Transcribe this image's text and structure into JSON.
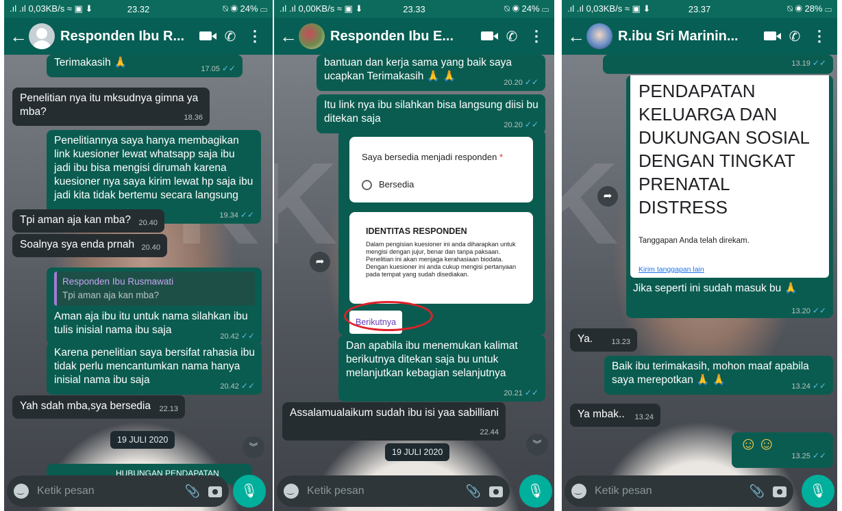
{
  "panel1": {
    "status": {
      "left": ".ıl .ıl 0,03KB/s ≈ ▣ ⬇",
      "time": "23.32",
      "right": "⍉ ◉ 24% ▭"
    },
    "header": {
      "title": "Responden Ibu R..."
    },
    "messages": [
      {
        "text": "Terimakasih 🙏",
        "time": "17.05"
      },
      {
        "text": "Penelitian nya itu mksudnya gimna ya mba?",
        "time": "18.36"
      },
      {
        "text": "Penelitiannya saya hanya membagikan link kuesioner lewat whatsapp saja ibu jadi ibu bisa mengisi dirumah karena kuesioner nya saya kirim lewat hp saja ibu jadi kita tidak bertemu secara langsung",
        "time": "19.34"
      },
      {
        "text": "Tpi aman aja kan mba?",
        "time": "20.40"
      },
      {
        "text": "Soalnya sya enda prnah",
        "time": "20.40"
      },
      {
        "quote_name": "Responden Ibu Rusmawati",
        "quote_text": "Tpi aman aja kan mba?",
        "text": "Aman aja ibu itu untuk nama silahkan ibu tulis inisial nama ibu saja",
        "time": "20.42"
      },
      {
        "text": "Karena penelitian saya bersifat rahasia ibu tidak perlu mencantumkan nama hanya inisial nama ibu saja",
        "time": "20.42"
      },
      {
        "text": "Yah sdah mba,sya bersedia",
        "time": "22.13"
      }
    ],
    "date": "19 JULI 2020",
    "partial": "HUBUNGAN PENDAPATAN",
    "input_placeholder": "Ketik pesan"
  },
  "panel2": {
    "status": {
      "left": ".ıl .ıl 0,00KB/s ≈ ▣ ⬇",
      "time": "23.33",
      "right": "⍉ ◉ 24% ▭"
    },
    "header": {
      "title": "Responden Ibu E..."
    },
    "messages": [
      {
        "text": "bantuan dan kerja sama yang baik saya ucapkan Terimakasih 🙏 🙏",
        "time": "20.20"
      },
      {
        "text": "Itu link nya ibu silahkan bisa langsung diisi bu ditekan saja",
        "time": "20.20"
      },
      {
        "text": "Dan apabila ibu menemukan kalimat berikutnya ditekan saja bu untuk melanjutkan kebagian selanjutnya",
        "time": "20.21"
      },
      {
        "text": "Assalamualaikum sudah ibu isi yaa sabilliani",
        "time": "22.44"
      }
    ],
    "form": {
      "question": "Saya bersedia menjadi responden",
      "required": "*",
      "option": "Bersedia",
      "section_title": "IDENTITAS RESPONDEN",
      "section_text": "Dalam pengisian kuesioner ini anda diharapkan untuk mengisi dengan jujur, benar dan tanpa paksaan. Penelitian ini akan menjaga kerahasiaan biodata. Dengan kuesioner ini anda cukup mengisi pertanyaan pada tempat yang sudah disediakan.",
      "next": "Berikutnya"
    },
    "date": "19 JULI 2020",
    "input_placeholder": "Ketik pesan"
  },
  "panel3": {
    "status": {
      "left": ".ıl .ıl 0,03KB/s ≈ ▣ ⬇",
      "time": "23.37",
      "right": "⍉ ◉ 28% ▭"
    },
    "header": {
      "title": "R.ibu Sri Marinin..."
    },
    "top_time": "13.19",
    "form": {
      "title": "PENDAPATAN KELUARGA DAN DUKUNGAN SOSIAL DENGAN TINGKAT PRENATAL DISTRESS",
      "recorded": "Tanggapan Anda telah direkam.",
      "link": "Kirim tanggapan lain"
    },
    "messages": [
      {
        "text": "Jika seperti ini sudah masuk bu 🙏",
        "time": "13.20"
      },
      {
        "text": "Ya.",
        "time": "13.23"
      },
      {
        "text": "Baik ibu terimakasih, mohon maaf apabila saya merepotkan 🙏 🙏",
        "time": "13.24"
      },
      {
        "text": "Ya mbak..",
        "time": "13.24"
      },
      {
        "text": "☺☺",
        "time": "13.25"
      }
    ],
    "input_placeholder": "Ketik pesan"
  }
}
